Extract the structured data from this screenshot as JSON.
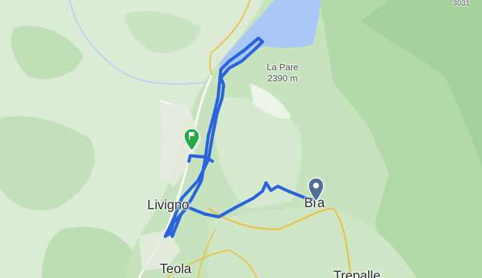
{
  "colors": {
    "lowland": "#e9eee4",
    "forest": "#bfe0b7",
    "forest_dark": "#a9d4a2",
    "water": "#a9c8f7",
    "route": "#2a63e0",
    "road_yellow": "#e6c44b",
    "start_marker": "#4e6f96",
    "finish_marker": "#25a94a"
  },
  "labels": {
    "peak_name": "La Pare",
    "peak_elevation": "2390 m",
    "town_livigno": "Livigno",
    "town_bra": "Bra",
    "town_teola": "Teola",
    "town_partial": "Trepalle",
    "corner_elevation": "3031"
  },
  "markers": {
    "start_icon": "location-pin-icon",
    "finish_icon": "flag-pin-icon"
  }
}
